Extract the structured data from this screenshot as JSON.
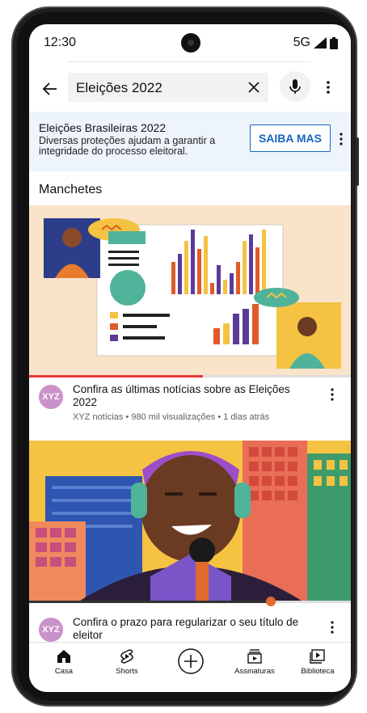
{
  "status": {
    "time": "12:30",
    "network": "5G"
  },
  "search": {
    "query": "Eleições 2022"
  },
  "banner": {
    "title": "Eleições Brasileiras 2022",
    "subtitle": "Diversas proteções ajudam a garantir a integridade do processo eleitoral.",
    "button": "SAIBA MAS"
  },
  "section": {
    "title": "Manchetes"
  },
  "videos": [
    {
      "channel_badge": "XYZ",
      "title": "Confira as últimas notícias sobre as Eleições 2022",
      "meta": "XYZ notícias • 980 mil visualizações • 1 dias atrás",
      "progress": 0.54
    },
    {
      "channel_badge": "XYZ",
      "title": "Confira o prazo para regularizar o seu título de eleitor",
      "progress": 0.75
    }
  ],
  "nav": [
    {
      "label": "Casa",
      "icon": "home-icon"
    },
    {
      "label": "Shorts",
      "icon": "shorts-icon"
    },
    {
      "label": "",
      "icon": "add-icon"
    },
    {
      "label": "Assinaturas",
      "icon": "subscriptions-icon"
    },
    {
      "label": "Biblioteca",
      "icon": "library-icon"
    }
  ],
  "colors": {
    "accent_blue": "#1565c0",
    "progress_red": "#e53935",
    "banner_bg": "#eef4fb"
  }
}
